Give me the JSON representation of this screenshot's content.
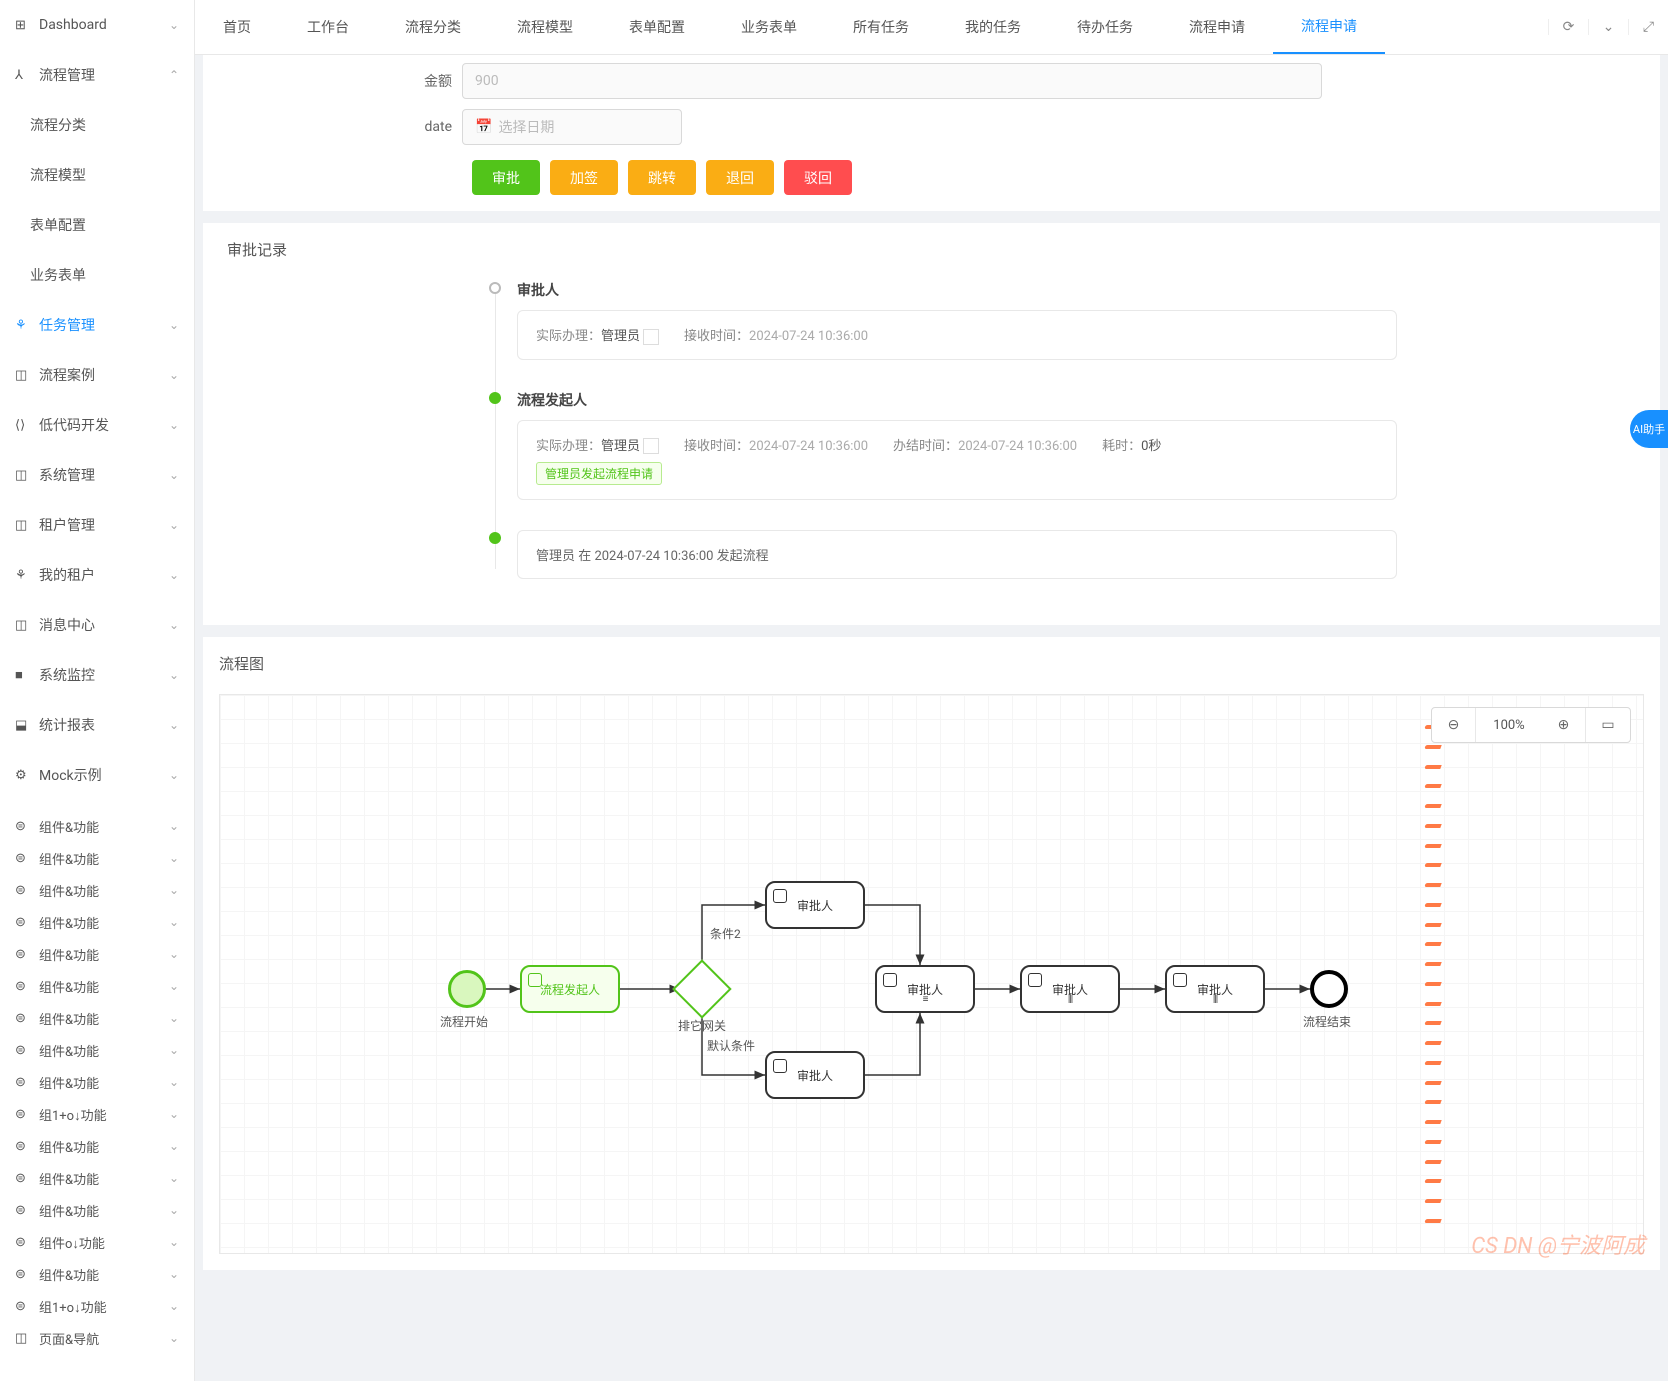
{
  "sidebar": {
    "items": [
      {
        "icon": "⊞",
        "label": "Dashboard",
        "chev": "⌄"
      },
      {
        "icon": "⅄",
        "label": "流程管理",
        "chev": "⌃"
      },
      {
        "icon": "",
        "label": "流程分类",
        "lvl2": true
      },
      {
        "icon": "",
        "label": "流程模型",
        "lvl2": true
      },
      {
        "icon": "",
        "label": "表单配置",
        "lvl2": true
      },
      {
        "icon": "",
        "label": "业务表单",
        "lvl2": true
      },
      {
        "icon": "⚘",
        "label": "任务管理",
        "chev": "⌄",
        "active": true
      },
      {
        "icon": "◫",
        "label": "流程案例",
        "chev": "⌄"
      },
      {
        "icon": "⟨⟩",
        "label": "低代码开发",
        "chev": "⌄"
      },
      {
        "icon": "◫",
        "label": "系统管理",
        "chev": "⌄"
      },
      {
        "icon": "◫",
        "label": "租户管理",
        "chev": "⌄"
      },
      {
        "icon": "⚘",
        "label": "我的租户",
        "chev": "⌄"
      },
      {
        "icon": "◫",
        "label": "消息中心",
        "chev": "⌄"
      },
      {
        "icon": "■",
        "label": "系统监控",
        "chev": "⌄"
      },
      {
        "icon": "⬓",
        "label": "统计报表",
        "chev": "⌄"
      },
      {
        "icon": "⚙",
        "label": "Mock示例",
        "chev": "⌄"
      }
    ],
    "extra": [
      {
        "icon": "⊜",
        "label": "组件&功能",
        "chev": "⌄"
      },
      {
        "icon": "⊜",
        "label": "组件&功能",
        "chev": "⌄"
      },
      {
        "icon": "⊜",
        "label": "组件&功能",
        "chev": "⌄"
      },
      {
        "icon": "⊜",
        "label": "组件&功能",
        "chev": "⌄"
      },
      {
        "icon": "⊜",
        "label": "组件&功能",
        "chev": "⌄"
      },
      {
        "icon": "⊜",
        "label": "组件&功能",
        "chev": "⌄"
      },
      {
        "icon": "⊜",
        "label": "组件&功能",
        "chev": "⌄"
      },
      {
        "icon": "⊜",
        "label": "组件&功能",
        "chev": "⌄"
      },
      {
        "icon": "⊜",
        "label": "组件&功能",
        "chev": "⌄"
      },
      {
        "icon": "⊜",
        "label": "组1+o↓功能",
        "chev": "⌄"
      },
      {
        "icon": "⊜",
        "label": "组件&功能",
        "chev": "⌄"
      },
      {
        "icon": "⊜",
        "label": "组件&功能",
        "chev": "⌄"
      },
      {
        "icon": "⊜",
        "label": "组件&功能",
        "chev": "⌄"
      },
      {
        "icon": "⊜",
        "label": "组件o↓功能",
        "chev": "⌄"
      },
      {
        "icon": "⊜",
        "label": "组件&功能",
        "chev": "⌄"
      },
      {
        "icon": "⊜",
        "label": "组1+o↓功能",
        "chev": "⌄"
      },
      {
        "icon": "◫",
        "label": "页面&导航",
        "chev": "⌄"
      }
    ]
  },
  "topbar": {
    "tabs": [
      "首页",
      "工作台",
      "流程分类",
      "流程模型",
      "表单配置",
      "业务表单",
      "所有任务",
      "我的任务",
      "待办任务",
      "流程申请",
      "流程申请"
    ],
    "activeIndex": 10
  },
  "form": {
    "amount_label": "金额",
    "amount_value": "900",
    "date_label": "date",
    "date_placeholder": "选择日期",
    "buttons": [
      "审批",
      "加签",
      "跳转",
      "退回",
      "驳回"
    ]
  },
  "approval": {
    "title": "审批记录",
    "items": [
      {
        "dot": "gray",
        "title": "审批人",
        "card": {
          "pairs": [
            {
              "k": "实际办理：",
              "v": "管理员",
              "box": true
            },
            {
              "k": "接收时间：",
              "v": "2024-07-24 10:36:00",
              "light": true
            }
          ]
        }
      },
      {
        "dot": "green",
        "title": "流程发起人",
        "card": {
          "pairs": [
            {
              "k": "实际办理：",
              "v": "管理员",
              "box": true
            },
            {
              "k": "接收时间：",
              "v": "2024-07-24 10:36:00",
              "light": true
            },
            {
              "k": "办结时间：",
              "v": "2024-07-24 10:36:00",
              "light": true
            },
            {
              "k": "耗时：",
              "v": "0秒"
            }
          ],
          "tag": "管理员发起流程申请"
        }
      },
      {
        "dot": "green",
        "title": "",
        "card": {
          "plain": "管理员 在 2024-07-24 10:36:00 发起流程"
        }
      }
    ]
  },
  "diagram": {
    "title": "流程图",
    "zoom": "100%",
    "labels": {
      "start": "流程开始",
      "initiator": "流程发起人",
      "gateway": "排它网关",
      "cond2": "条件2",
      "default": "默认条件",
      "approver": "审批人",
      "end": "流程结束"
    }
  },
  "ai": "AI助手",
  "watermark": "CS DN @宁波阿成"
}
